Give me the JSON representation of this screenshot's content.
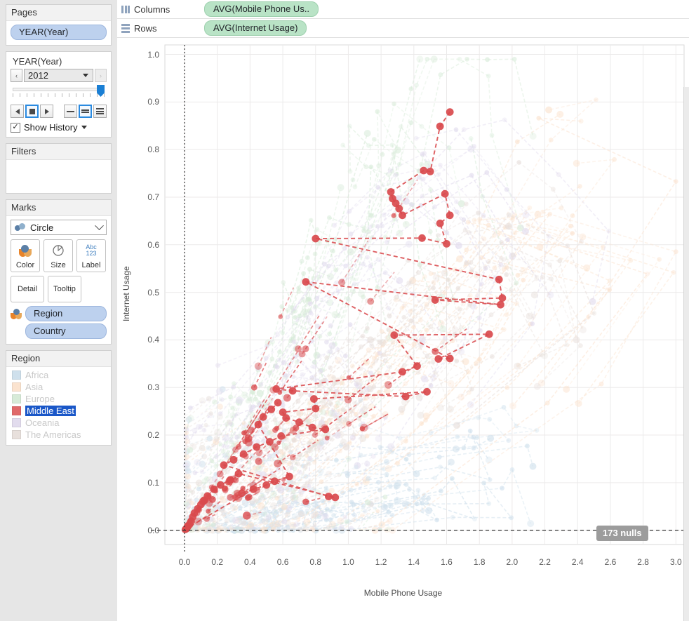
{
  "sidebar": {
    "pages": {
      "title": "Pages",
      "field_pill": "YEAR(Year)"
    },
    "page_control": {
      "title": "YEAR(Year)",
      "value": "2012",
      "prev_label": "‹",
      "next_label": "›",
      "show_history_label": "Show History",
      "checked": true,
      "tick_count": 14,
      "speed_modes": [
        "slow",
        "medium",
        "fast"
      ],
      "selected_speed": "medium",
      "selected_playback": "stop"
    },
    "filters": {
      "title": "Filters",
      "items": []
    },
    "marks": {
      "title": "Marks",
      "mark_type": "Circle",
      "buttons": [
        "Color",
        "Size",
        "Label",
        "Detail",
        "Tooltip"
      ],
      "color_label": "Color",
      "size_label": "Size",
      "label_label": "Label",
      "label_glyph_top": "Abc",
      "label_glyph_bottom": "123",
      "detail_label": "Detail",
      "tooltip_label": "Tooltip",
      "encodings": [
        {
          "field": "Region",
          "shelf": "color"
        },
        {
          "field": "Country",
          "shelf": "detail"
        }
      ]
    },
    "legend": {
      "title": "Region",
      "items": [
        {
          "label": "Africa",
          "color": "#cfe0ec",
          "selected": false
        },
        {
          "label": "Asia",
          "color": "#fbe3cf",
          "selected": false
        },
        {
          "label": "Europe",
          "color": "#d7ebd8",
          "selected": false
        },
        {
          "label": "Middle East",
          "color": "#e0696a",
          "selected": true
        },
        {
          "label": "Oceania",
          "color": "#e2dcee",
          "selected": false
        },
        {
          "label": "The Americas",
          "color": "#e8e0dc",
          "selected": false
        }
      ]
    }
  },
  "shelves": [
    {
      "name": "Columns",
      "label": "Columns",
      "pill": "AVG(Mobile Phone Us.."
    },
    {
      "name": "Rows",
      "label": "Rows",
      "pill": "AVG(Internet Usage)"
    }
  ],
  "viz": {
    "nulls_badge": "173 nulls",
    "x_axis_title": "Mobile Phone Usage",
    "y_axis_title": "Internet Usage"
  },
  "chart_data": {
    "type": "scatter",
    "title": "",
    "xlabel": "Mobile Phone Usage",
    "ylabel": "Internet Usage",
    "xlim": [
      -0.12,
      3.05
    ],
    "ylim": [
      -0.03,
      1.02
    ],
    "xticks": [
      "0.0",
      "0.2",
      "0.4",
      "0.6",
      "0.8",
      "1.0",
      "1.2",
      "1.4",
      "1.6",
      "1.8",
      "2.0",
      "2.2",
      "2.4",
      "2.6",
      "2.8",
      "3.0"
    ],
    "yticks": [
      "0.0",
      "0.1",
      "0.2",
      "0.3",
      "0.4",
      "0.5",
      "0.6",
      "0.7",
      "0.8",
      "0.9",
      "1.0"
    ],
    "grid": true,
    "legend_position": "left-panel",
    "reference_lines": [
      {
        "axis": "x",
        "value": 0.0,
        "style": "dotted",
        "color": "#333333"
      },
      {
        "axis": "y",
        "value": 0.0,
        "style": "dashed",
        "color": "#333333"
      }
    ],
    "annotations": [
      {
        "text": "173 nulls",
        "position": "bottom-right"
      }
    ],
    "highlight_series": "Middle East",
    "page_field": "YEAR(Year)",
    "page_value": "2012",
    "trails": true,
    "series": [
      {
        "name": "Middle East",
        "color": "#d94a4d",
        "opacity": 1.0,
        "points": [
          [
            1.62,
            0.879
          ],
          [
            1.56,
            0.849
          ],
          [
            1.5,
            0.754
          ],
          [
            1.46,
            0.756
          ],
          [
            1.26,
            0.711
          ],
          [
            1.27,
            0.697
          ],
          [
            1.29,
            0.687
          ],
          [
            1.31,
            0.676
          ],
          [
            1.33,
            0.662
          ],
          [
            1.59,
            0.707
          ],
          [
            1.62,
            0.662
          ],
          [
            1.56,
            0.645
          ],
          [
            1.6,
            0.602
          ],
          [
            1.45,
            0.614
          ],
          [
            0.8,
            0.613
          ],
          [
            1.92,
            0.527
          ],
          [
            1.94,
            0.488
          ],
          [
            1.53,
            0.484
          ],
          [
            1.93,
            0.474
          ],
          [
            0.74,
            0.522
          ],
          [
            1.62,
            0.361
          ],
          [
            1.55,
            0.36
          ],
          [
            1.86,
            0.412
          ],
          [
            1.28,
            0.41
          ],
          [
            1.42,
            0.345
          ],
          [
            1.33,
            0.333
          ],
          [
            0.56,
            0.297
          ],
          [
            0.66,
            0.293
          ],
          [
            1.35,
            0.281
          ],
          [
            1.48,
            0.291
          ],
          [
            0.79,
            0.276
          ],
          [
            0.8,
            0.256
          ],
          [
            0.6,
            0.248
          ],
          [
            0.62,
            0.236
          ],
          [
            0.7,
            0.227
          ],
          [
            0.78,
            0.216
          ],
          [
            0.86,
            0.212
          ],
          [
            0.59,
            0.198
          ],
          [
            0.52,
            0.186
          ],
          [
            0.44,
            0.175
          ],
          [
            0.36,
            0.16
          ],
          [
            0.3,
            0.148
          ],
          [
            0.24,
            0.137
          ],
          [
            0.88,
            0.071
          ],
          [
            0.92,
            0.069
          ],
          [
            0.33,
            0.119
          ],
          [
            0.28,
            0.106
          ],
          [
            0.22,
            0.095
          ],
          [
            0.18,
            0.086
          ],
          [
            0.14,
            0.072
          ],
          [
            0.12,
            0.063
          ],
          [
            0.1,
            0.054
          ],
          [
            0.08,
            0.045
          ],
          [
            0.06,
            0.036
          ],
          [
            0.05,
            0.028
          ],
          [
            0.04,
            0.019
          ],
          [
            0.03,
            0.012
          ],
          [
            0.02,
            0.008
          ],
          [
            0.015,
            0.005
          ],
          [
            0.01,
            0.003
          ],
          [
            0.42,
            0.086
          ],
          [
            0.35,
            0.078
          ],
          [
            0.5,
            0.095
          ],
          [
            0.55,
            0.103
          ],
          [
            0.64,
            0.113
          ],
          [
            0.45,
            0.222
          ],
          [
            0.48,
            0.238
          ],
          [
            0.53,
            0.254
          ],
          [
            0.57,
            0.268
          ]
        ]
      },
      {
        "name": "Africa",
        "color": "#cfe0ec",
        "opacity": 0.55,
        "points": [
          [
            0.1,
            0.02
          ],
          [
            0.3,
            0.05
          ],
          [
            0.6,
            0.08
          ],
          [
            1.0,
            0.1
          ],
          [
            1.3,
            0.12
          ],
          [
            1.75,
            0.139
          ],
          [
            1.8,
            0.142
          ],
          [
            1.9,
            0.088
          ],
          [
            1.6,
            0.086
          ],
          [
            0.9,
            0.055
          ],
          [
            0.5,
            0.035
          ],
          [
            0.2,
            0.015
          ]
        ]
      },
      {
        "name": "Asia",
        "color": "#fbe3cf",
        "opacity": 0.55,
        "points": [
          [
            0.2,
            0.04
          ],
          [
            0.6,
            0.12
          ],
          [
            1.0,
            0.22
          ],
          [
            1.4,
            0.34
          ],
          [
            1.7,
            0.46
          ],
          [
            2.0,
            0.63
          ],
          [
            2.25,
            0.729
          ],
          [
            2.05,
            0.718
          ],
          [
            2.9,
            0.613
          ],
          [
            2.3,
            0.355
          ],
          [
            1.2,
            0.051
          ],
          [
            0.8,
            0.03
          ]
        ]
      },
      {
        "name": "Europe",
        "color": "#d7ebd8",
        "opacity": 0.55,
        "points": [
          [
            0.5,
            0.2
          ],
          [
            0.8,
            0.4
          ],
          [
            1.0,
            0.58
          ],
          [
            1.15,
            0.72
          ],
          [
            1.25,
            0.84
          ],
          [
            1.32,
            0.963
          ],
          [
            1.45,
            0.905
          ],
          [
            1.62,
            0.897
          ],
          [
            1.7,
            0.742
          ],
          [
            1.85,
            0.58
          ],
          [
            0.95,
            0.3
          ],
          [
            0.6,
            0.12
          ]
        ]
      },
      {
        "name": "Oceania",
        "color": "#e2dcee",
        "opacity": 0.55,
        "points": [
          [
            0.15,
            0.258
          ],
          [
            0.4,
            0.3
          ],
          [
            0.7,
            0.45
          ],
          [
            1.0,
            0.6
          ],
          [
            1.3,
            0.7
          ],
          [
            1.55,
            0.745
          ],
          [
            1.8,
            0.64
          ],
          [
            2.05,
            0.52
          ],
          [
            1.95,
            0.4
          ],
          [
            1.6,
            0.25
          ],
          [
            0.9,
            0.14
          ]
        ]
      },
      {
        "name": "The Americas",
        "color": "#e8e0dc",
        "opacity": 0.55,
        "points": [
          [
            0.2,
            0.06
          ],
          [
            0.5,
            0.16
          ],
          [
            0.9,
            0.28
          ],
          [
            1.2,
            0.4
          ],
          [
            1.5,
            0.52
          ],
          [
            1.75,
            0.6
          ],
          [
            2.0,
            0.56
          ],
          [
            2.15,
            0.44
          ],
          [
            1.9,
            0.355
          ],
          [
            1.4,
            0.22
          ],
          [
            0.7,
            0.1
          ]
        ]
      }
    ]
  }
}
